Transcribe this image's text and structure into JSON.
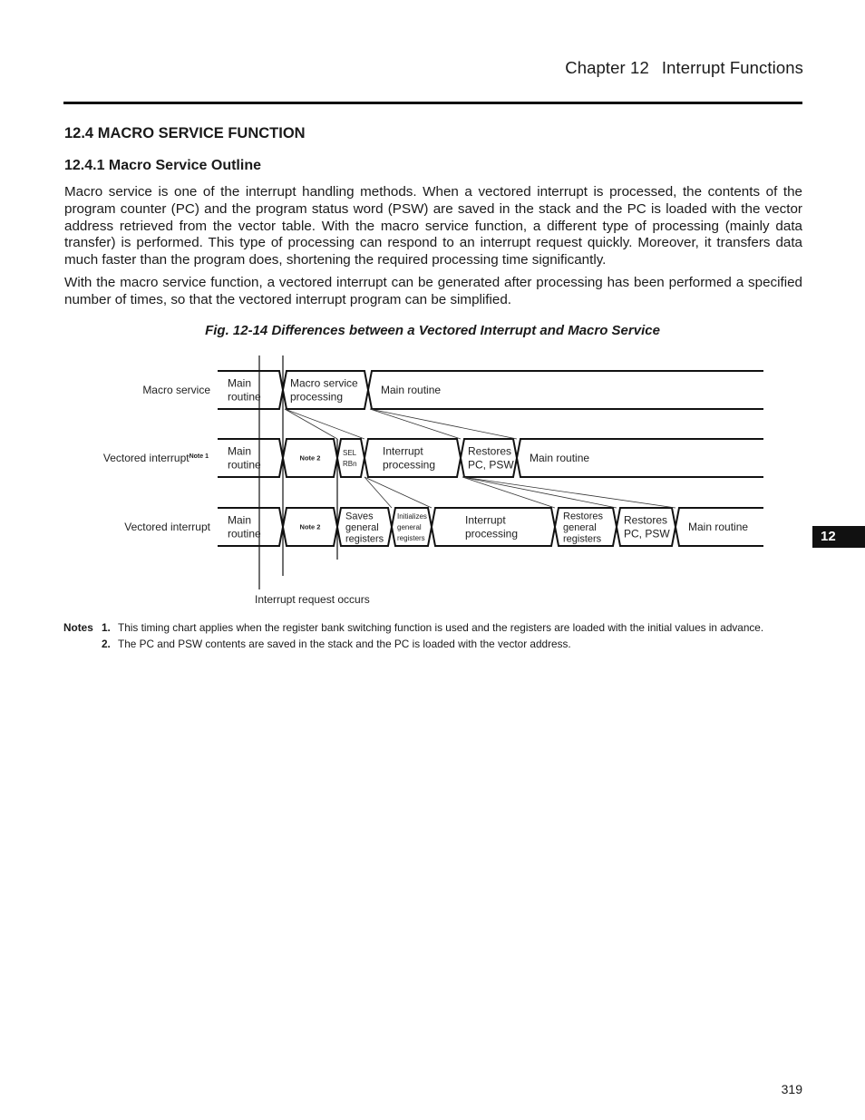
{
  "header": {
    "chapter": "Chapter 12",
    "chapter_title": "Interrupt Functions"
  },
  "section": {
    "title": "12.4  MACRO SERVICE FUNCTION",
    "subsection_title": "12.4.1  Macro Service Outline"
  },
  "body": {
    "paragraph_1": "Macro service is one of the interrupt handling methods.  When a vectored interrupt is processed, the contents of the program counter (PC) and the program status word (PSW) are saved in the stack and the PC is loaded with the vector address retrieved from the vector table.  With the macro service function, a different type of processing (mainly data transfer) is performed. This type of processing can respond to an interrupt request quickly. Moreover, it transfers data much faster than the program does, shortening the required processing time significantly.",
    "paragraph_2": "With the macro service function, a vectored interrupt can be generated after processing has been performed a specified number of times, so that the vectored interrupt program can be simplified."
  },
  "figure": {
    "caption": "Fig. 12-14  Differences between a Vectored Interrupt and Macro Service",
    "rows": [
      {
        "label": "Macro service",
        "label_note": "",
        "segments": [
          {
            "lines": [
              "Main",
              "routine"
            ]
          },
          {
            "lines": [
              "Macro service",
              "processing"
            ]
          },
          {
            "lines": [
              "Main routine"
            ]
          }
        ]
      },
      {
        "label": "Vectored interrupt",
        "label_note": "Note 1",
        "segments": [
          {
            "lines": [
              "Main",
              "routine"
            ]
          },
          {
            "lines": [
              "Note 2"
            ],
            "style": "note"
          },
          {
            "lines": [
              "SEL",
              "RBn"
            ],
            "style": "tiny"
          },
          {
            "lines": [
              "Interrupt",
              "processing"
            ]
          },
          {
            "lines": [
              "Restores",
              "PC, PSW"
            ]
          },
          {
            "lines": [
              "Main routine"
            ]
          }
        ]
      },
      {
        "label": "Vectored interrupt",
        "label_note": "",
        "segments": [
          {
            "lines": [
              "Main",
              "routine"
            ]
          },
          {
            "lines": [
              "Note 2"
            ],
            "style": "note"
          },
          {
            "lines": [
              "Saves",
              "general",
              "registers"
            ],
            "style": "small"
          },
          {
            "lines": [
              "Initializes",
              "general",
              "registers"
            ],
            "style": "tiny"
          },
          {
            "lines": [
              "Interrupt",
              "processing"
            ]
          },
          {
            "lines": [
              "Restores",
              "general",
              "registers"
            ],
            "style": "small"
          },
          {
            "lines": [
              "Restores",
              "PC, PSW"
            ]
          },
          {
            "lines": [
              "Main routine"
            ]
          }
        ]
      }
    ],
    "marker_label": "Interrupt request occurs"
  },
  "notes": {
    "heading": "Notes",
    "items": [
      {
        "number": "1.",
        "text": "This timing chart applies when the register bank switching function is used and the registers are loaded with the initial values in advance."
      },
      {
        "number": "2.",
        "text": "The PC and PSW contents are saved in the stack and the PC is loaded with the vector address."
      }
    ]
  },
  "chapter_tab": "12",
  "page_number": "319"
}
